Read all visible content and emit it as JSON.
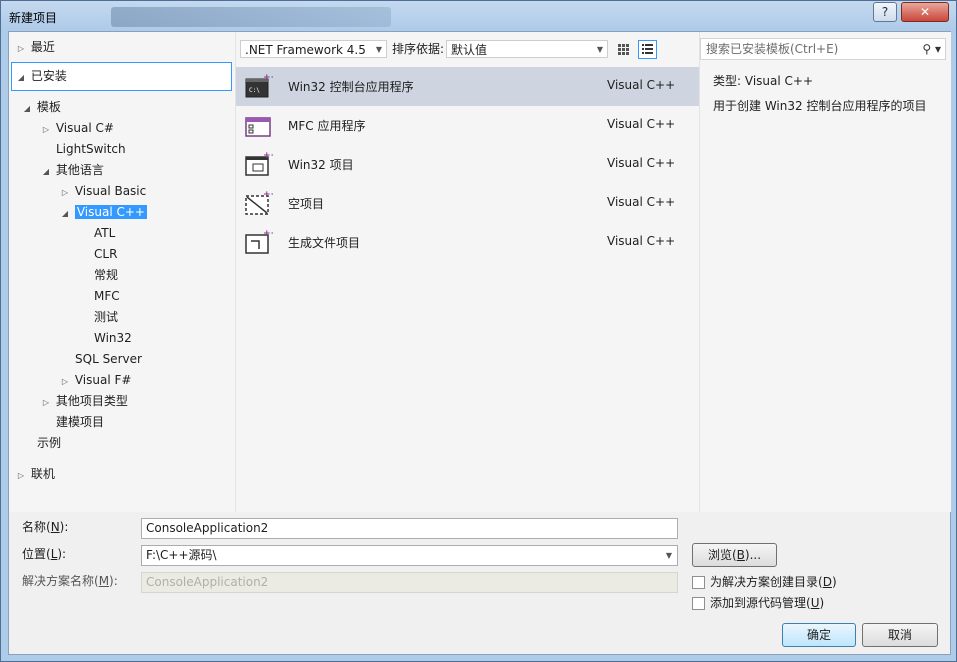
{
  "window": {
    "title": "新建项目",
    "help": "?",
    "close": "✕"
  },
  "left": {
    "recent": "最近",
    "installed": "已安装",
    "templates": "模板",
    "visual_csharp": "Visual C#",
    "lightswitch": "LightSwitch",
    "other_languages": "其他语言",
    "visual_basic": "Visual Basic",
    "visual_cpp": "Visual C++",
    "atl": "ATL",
    "clr": "CLR",
    "general": "常规",
    "mfc": "MFC",
    "test": "测试",
    "win32": "Win32",
    "sql_server": "SQL Server",
    "visual_fsharp": "Visual F#",
    "other_project_types": "其他项目类型",
    "modeling_projects": "建模项目",
    "samples": "示例",
    "online": "联机"
  },
  "toolbar": {
    "framework": ".NET Framework 4.5",
    "sort_label": "排序依据:",
    "sort_value": "默认值"
  },
  "templates": [
    {
      "name": "Win32 控制台应用程序",
      "language": "Visual C++",
      "icon": "console-app-icon"
    },
    {
      "name": "MFC 应用程序",
      "language": "Visual C++",
      "icon": "mfc-app-icon"
    },
    {
      "name": "Win32 项目",
      "language": "Visual C++",
      "icon": "win32-project-icon"
    },
    {
      "name": "空项目",
      "language": "Visual C++",
      "icon": "empty-project-icon"
    },
    {
      "name": "生成文件项目",
      "language": "Visual C++",
      "icon": "makefile-project-icon"
    }
  ],
  "search": {
    "placeholder": "搜索已安装模板(Ctrl+E)"
  },
  "details": {
    "type_label": "类型:",
    "type_value": "Visual C++",
    "description": "用于创建 Win32 控制台应用程序的项目"
  },
  "form": {
    "name_label": "名称(",
    "name_key": "N",
    "name_suffix": "):",
    "name_value": "ConsoleApplication2",
    "location_label": "位置(",
    "location_key": "L",
    "location_suffix": "):",
    "location_value": "F:\\C++源码\\",
    "solution_label": "解决方案名称(",
    "solution_key": "M",
    "solution_suffix": "):",
    "solution_value": "ConsoleApplication2",
    "browse_label": "浏览(",
    "browse_key": "B",
    "browse_suffix": ")...",
    "create_dir_label": "为解决方案创建目录(",
    "create_dir_key": "D",
    "create_dir_suffix": ")",
    "source_control_label": "添加到源代码管理(",
    "source_control_key": "U",
    "source_control_suffix": ")",
    "ok": "确定",
    "cancel": "取消"
  }
}
